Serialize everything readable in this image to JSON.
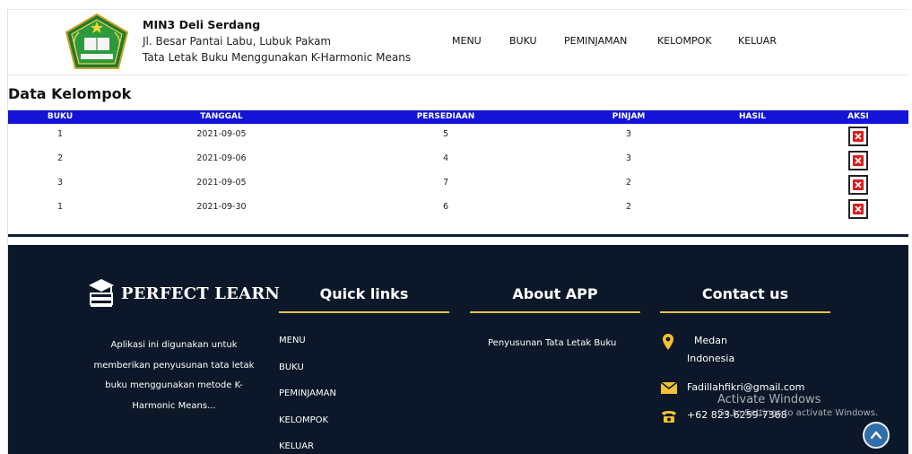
{
  "header": {
    "school_name": "MIN3 Deli Serdang",
    "address": "Jl. Besar Pantai Labu, Lubuk Pakam",
    "subtitle": "Tata Letak Buku Menggunakan K-Harmonic Means",
    "nav": [
      "MENU",
      "BUKU",
      "PEMINJAMAN",
      "KELOMPOK",
      "KELUAR"
    ]
  },
  "page_title": "Data Kelompok",
  "table": {
    "columns": [
      "BUKU",
      "TANGGAL",
      "PERSEDIAAN",
      "PINJAM",
      "HASIL",
      "AKSI"
    ],
    "rows": [
      {
        "buku": "1",
        "tanggal": "2021-09-05",
        "persediaan": "5",
        "pinjam": "3",
        "hasil": ""
      },
      {
        "buku": "2",
        "tanggal": "2021-09-06",
        "persediaan": "4",
        "pinjam": "3",
        "hasil": ""
      },
      {
        "buku": "3",
        "tanggal": "2021-09-05",
        "persediaan": "7",
        "pinjam": "2",
        "hasil": ""
      },
      {
        "buku": "1",
        "tanggal": "2021-09-30",
        "persediaan": "6",
        "pinjam": "2",
        "hasil": ""
      }
    ],
    "action_icon": "delete-icon"
  },
  "footer": {
    "brand": "PERFECT LEARN",
    "description": [
      "Aplikasi ini digunakan untuk",
      "memberikan penyusunan tata letak",
      "buku menggunakan metode K-",
      "Harmonic Means..."
    ],
    "quick_links_title": "Quick links",
    "quick_links": [
      "MENU",
      "BUKU",
      "PEMINJAMAN",
      "KELOMPOK",
      "KELUAR"
    ],
    "about_title": "About APP",
    "about_text": "Penyusunan Tata Letak Buku",
    "contact_title": "Contact us",
    "location_line1": "Medan",
    "location_line2": "Indonesia",
    "email": "Fadillahfikri@gmail.com",
    "phone": "+62 823-6259-7368"
  },
  "overlay": {
    "activate_title": "Activate Windows",
    "activate_sub": "Go to Settings to activate Windows."
  },
  "colors": {
    "table_header": "#1414d6",
    "footer_bg": "#0c1829",
    "accent_gold": "#e8c542",
    "delete_red": "#e01a1a"
  }
}
